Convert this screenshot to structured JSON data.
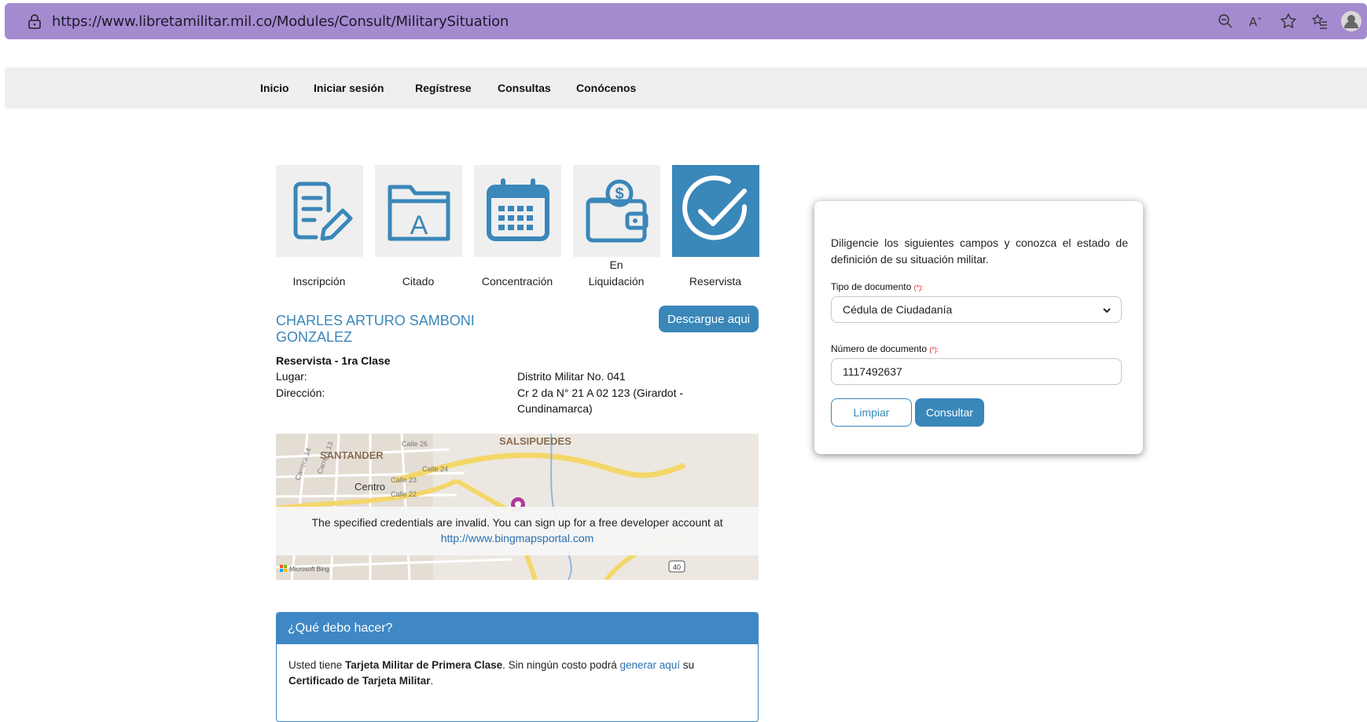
{
  "browser": {
    "url": "https://www.libretamilitar.mil.co/Modules/Consult/MilitarySituation",
    "zoom_icon": "zoom-out-icon",
    "read_aloud_icon": "read-aloud-icon",
    "favorite_icon": "star-icon",
    "favorites_icon": "favorites-list-icon",
    "profile_icon": "profile-icon"
  },
  "nav": {
    "items": [
      "Inicio",
      "Iniciar sesión",
      "Regístrese",
      "Consultas",
      "Conócenos"
    ]
  },
  "steps": [
    {
      "label": "Inscripción",
      "icon": "document-edit-icon"
    },
    {
      "label": "Citado",
      "icon": "folder-icon",
      "letter": "A"
    },
    {
      "label": "Concentración",
      "icon": "calendar-icon"
    },
    {
      "label_top": "En",
      "label": "Liquidación",
      "icon": "wallet-icon"
    },
    {
      "label": "Reservista",
      "icon": "check-circle-icon",
      "active": true
    }
  ],
  "person": {
    "name_line1": "CHARLES ARTURO SAMBONI",
    "name_line2": "GONZALEZ",
    "download_label": "Descargue aqui",
    "status": "Reservista - 1ra Clase",
    "place_label": "Lugar:",
    "place_value": "Distrito Militar No. 041",
    "address_label": "Dirección:",
    "address_line1": "Cr 2 da N° 21 A 02 123 (Girardot -",
    "address_line2": "Cundinamarca)"
  },
  "map": {
    "labels": [
      "SANTANDER",
      "SALSIPUEDES",
      "Centro",
      "Calle 26",
      "Calle 24",
      "Calle 23",
      "Calle 22",
      "Carrera 14",
      "Carrera 13",
      "40",
      "Microsoft Bing"
    ],
    "error_line1": "The specified credentials are invalid. You can sign up for a free developer account at",
    "error_link": "http://www.bingmapsportal.com"
  },
  "help": {
    "title": "¿Qué debo hacer?",
    "t1": "Usted tiene ",
    "b1": "Tarjeta Militar de Primera Clase",
    "t2": ". Sin ningún costo podrá ",
    "link": "generar aquí",
    "t3": " su",
    "b2": "Certificado de Tarjeta Militar",
    "t4": "."
  },
  "form": {
    "intro": "Diligencie los siguientes campos y conozca el estado de definición de su situación militar.",
    "doc_type_label": "Tipo de documento",
    "required_mark": "(*):",
    "doc_type_value": "Cédula de Ciudadanía",
    "doc_number_label": "Número de documento",
    "doc_number_value": "1117492637",
    "clear_label": "Limpiar",
    "submit_label": "Consultar"
  },
  "colors": {
    "accent": "#3a87b9",
    "browser_bar": "#a48bd0",
    "panel_header": "#3f88c5"
  }
}
